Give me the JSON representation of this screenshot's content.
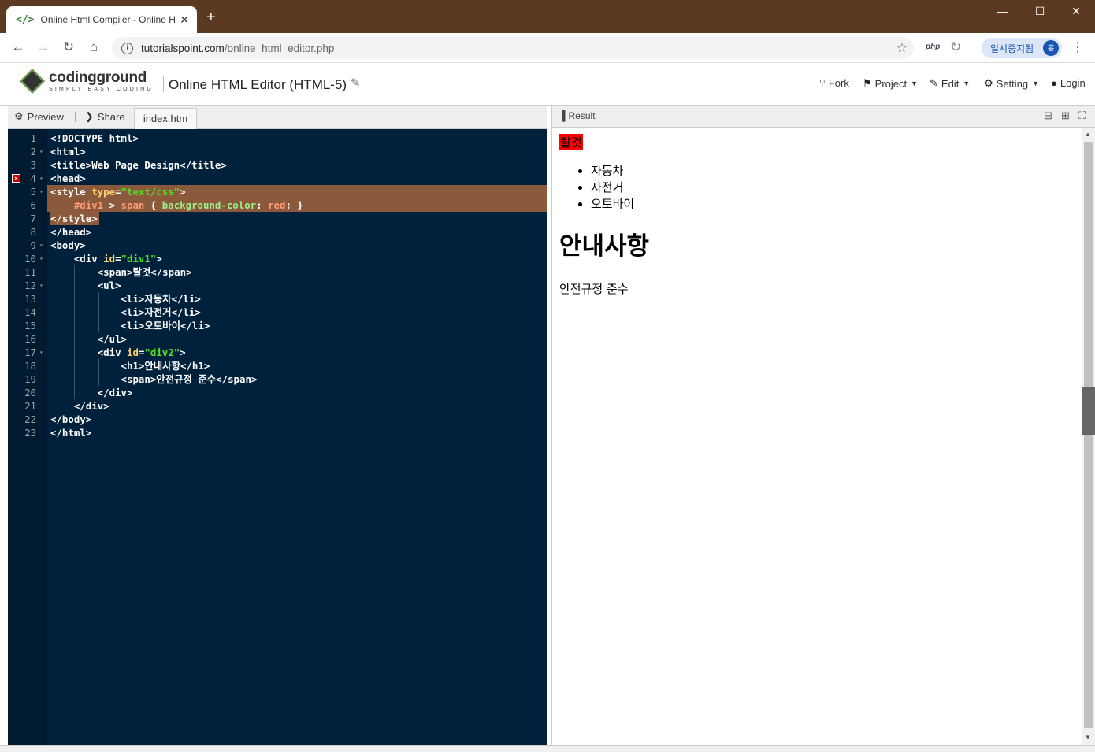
{
  "browser": {
    "tab_title": "Online Html Compiler - Online H",
    "tab_icon": "</>",
    "new_tab": "+",
    "url_host": "tutorialspoint.com",
    "url_path": "/online_html_editor.php",
    "php_ext": "php",
    "pause_label": "일시중지됨",
    "avatar_initial": "흠"
  },
  "site": {
    "logo_name": "codingground",
    "logo_tagline": "SIMPLY EASY CODING",
    "page_title": "Online HTML Editor (HTML-5)",
    "menu": {
      "fork": "Fork",
      "project": "Project",
      "edit": "Edit",
      "setting": "Setting",
      "login": "Login"
    }
  },
  "editor": {
    "preview_label": "Preview",
    "share_label": "Share",
    "file_tab": "index.htm",
    "error_line": 4,
    "highlighted_lines": [
      5,
      6
    ],
    "lines": [
      {
        "n": "1",
        "fold": "",
        "segs": [
          [
            "t-tag",
            "<!DOCTYPE html>"
          ]
        ]
      },
      {
        "n": "2",
        "fold": "▾",
        "segs": [
          [
            "t-tag",
            "<html>"
          ]
        ]
      },
      {
        "n": "3",
        "fold": "",
        "segs": [
          [
            "t-tag",
            "<title>"
          ],
          [
            "t-text",
            "Web Page Design"
          ],
          [
            "t-tag",
            "</title>"
          ]
        ]
      },
      {
        "n": "4",
        "fold": "▾",
        "segs": [
          [
            "t-tag",
            "<head>"
          ]
        ]
      },
      {
        "n": "5",
        "fold": "▾",
        "segs": [
          [
            "t-tag",
            "<style "
          ],
          [
            "t-attr",
            "type"
          ],
          [
            "t-tag",
            "="
          ],
          [
            "t-str",
            "\"text/css\""
          ],
          [
            "t-tag",
            ">"
          ]
        ]
      },
      {
        "n": "6",
        "fold": "",
        "segs": [
          [
            "t-text",
            "    "
          ],
          [
            "t-sel",
            "#div1"
          ],
          [
            "t-tag",
            " > "
          ],
          [
            "t-sel",
            "span"
          ],
          [
            "t-tag",
            " { "
          ],
          [
            "t-prop",
            "background-color"
          ],
          [
            "t-tag",
            ": "
          ],
          [
            "t-val",
            "red"
          ],
          [
            "t-tag",
            "; }"
          ]
        ]
      },
      {
        "n": "7",
        "fold": "",
        "segs": [
          [
            "t-tag",
            "</style>"
          ]
        ]
      },
      {
        "n": "8",
        "fold": "",
        "segs": [
          [
            "t-tag",
            "</head>"
          ]
        ]
      },
      {
        "n": "9",
        "fold": "▾",
        "segs": [
          [
            "t-tag",
            "<body>"
          ]
        ]
      },
      {
        "n": "10",
        "fold": "▾",
        "segs": [
          [
            "t-text",
            "    "
          ],
          [
            "t-tag",
            "<div "
          ],
          [
            "t-attr",
            "id"
          ],
          [
            "t-tag",
            "="
          ],
          [
            "t-str",
            "\"div1\""
          ],
          [
            "t-tag",
            ">"
          ]
        ]
      },
      {
        "n": "11",
        "fold": "",
        "segs": [
          [
            "t-text",
            "        "
          ],
          [
            "t-tag",
            "<span>"
          ],
          [
            "t-text",
            "탈것"
          ],
          [
            "t-tag",
            "</span>"
          ]
        ]
      },
      {
        "n": "12",
        "fold": "▾",
        "segs": [
          [
            "t-text",
            "        "
          ],
          [
            "t-tag",
            "<ul>"
          ]
        ]
      },
      {
        "n": "13",
        "fold": "",
        "segs": [
          [
            "t-text",
            "            "
          ],
          [
            "t-tag",
            "<li>"
          ],
          [
            "t-text",
            "자동차"
          ],
          [
            "t-tag",
            "</li>"
          ]
        ]
      },
      {
        "n": "14",
        "fold": "",
        "segs": [
          [
            "t-text",
            "            "
          ],
          [
            "t-tag",
            "<li>"
          ],
          [
            "t-text",
            "자전거"
          ],
          [
            "t-tag",
            "</li>"
          ]
        ]
      },
      {
        "n": "15",
        "fold": "",
        "segs": [
          [
            "t-text",
            "            "
          ],
          [
            "t-tag",
            "<li>"
          ],
          [
            "t-text",
            "오토바이"
          ],
          [
            "t-tag",
            "</li>"
          ]
        ]
      },
      {
        "n": "16",
        "fold": "",
        "segs": [
          [
            "t-text",
            "        "
          ],
          [
            "t-tag",
            "</ul>"
          ]
        ]
      },
      {
        "n": "17",
        "fold": "▾",
        "segs": [
          [
            "t-text",
            "        "
          ],
          [
            "t-tag",
            "<div "
          ],
          [
            "t-attr",
            "id"
          ],
          [
            "t-tag",
            "="
          ],
          [
            "t-str",
            "\"div2\""
          ],
          [
            "t-tag",
            ">"
          ]
        ]
      },
      {
        "n": "18",
        "fold": "",
        "segs": [
          [
            "t-text",
            "            "
          ],
          [
            "t-tag",
            "<h1>"
          ],
          [
            "t-text",
            "안내사항"
          ],
          [
            "t-tag",
            "</h1>"
          ]
        ]
      },
      {
        "n": "19",
        "fold": "",
        "segs": [
          [
            "t-text",
            "            "
          ],
          [
            "t-tag",
            "<span>"
          ],
          [
            "t-text",
            "안전규정 준수"
          ],
          [
            "t-tag",
            "</span>"
          ]
        ]
      },
      {
        "n": "20",
        "fold": "",
        "segs": [
          [
            "t-text",
            "        "
          ],
          [
            "t-tag",
            "</div>"
          ]
        ]
      },
      {
        "n": "21",
        "fold": "",
        "segs": [
          [
            "t-text",
            "    "
          ],
          [
            "t-tag",
            "</div>"
          ]
        ]
      },
      {
        "n": "22",
        "fold": "",
        "segs": [
          [
            "t-tag",
            "</body>"
          ]
        ]
      },
      {
        "n": "23",
        "fold": "",
        "segs": [
          [
            "t-tag",
            "</html>"
          ]
        ]
      }
    ]
  },
  "result": {
    "label": "Result",
    "span_text": "탈것",
    "list_items": [
      "자동차",
      "자전거",
      "오토바이"
    ],
    "heading": "안내사항",
    "note": "안전규정 준수"
  },
  "colors": {
    "titlebar": "#5c3a22",
    "editor_bg": "#00213c",
    "highlight": "#8b5a3c",
    "span_bg": "#ff0000"
  }
}
